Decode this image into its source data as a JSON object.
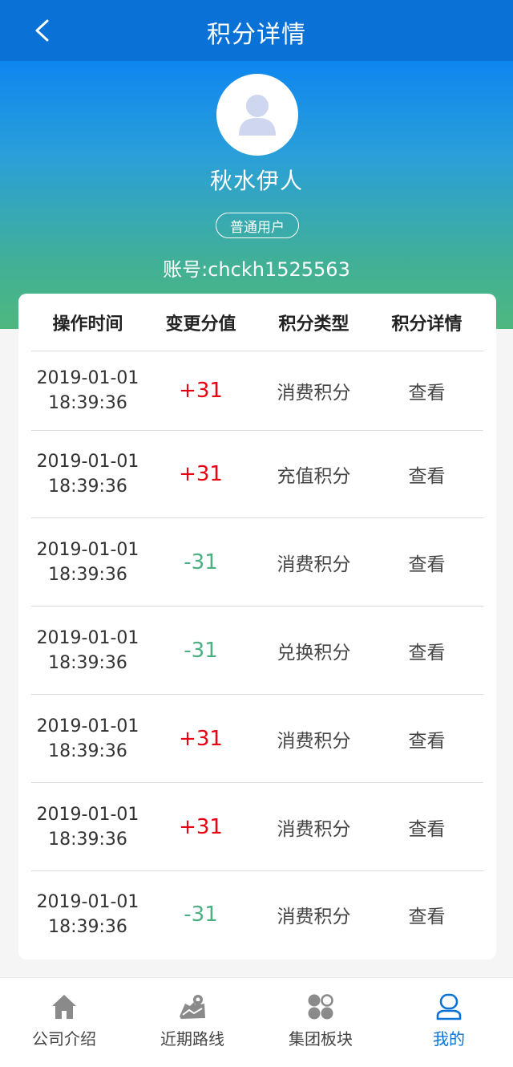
{
  "header": {
    "title": "积分详情"
  },
  "profile": {
    "name": "秋水伊人",
    "badge": "普通用户",
    "account": "账号:chckh1525563"
  },
  "table": {
    "columns": [
      "操作时间",
      "变更分值",
      "积分类型",
      "积分详情"
    ],
    "rows": [
      {
        "date": "2019-01-01",
        "time": "18:39:36",
        "value": "+31",
        "sign": "pos",
        "type": "消费积分",
        "action": "查看"
      },
      {
        "date": "2019-01-01",
        "time": "18:39:36",
        "value": "+31",
        "sign": "pos",
        "type": "充值积分",
        "action": "查看"
      },
      {
        "date": "2019-01-01",
        "time": "18:39:36",
        "value": "-31",
        "sign": "neg",
        "type": "消费积分",
        "action": "查看"
      },
      {
        "date": "2019-01-01",
        "time": "18:39:36",
        "value": "-31",
        "sign": "neg",
        "type": "兑换积分",
        "action": "查看"
      },
      {
        "date": "2019-01-01",
        "time": "18:39:36",
        "value": "+31",
        "sign": "pos",
        "type": "消费积分",
        "action": "查看"
      },
      {
        "date": "2019-01-01",
        "time": "18:39:36",
        "value": "+31",
        "sign": "pos",
        "type": "消费积分",
        "action": "查看"
      },
      {
        "date": "2019-01-01",
        "time": "18:39:36",
        "value": "-31",
        "sign": "neg",
        "type": "消费积分",
        "action": "查看"
      }
    ]
  },
  "tabbar": {
    "items": [
      {
        "label": "公司介绍",
        "icon": "home-icon"
      },
      {
        "label": "近期路线",
        "icon": "map-icon"
      },
      {
        "label": "集团板块",
        "icon": "grid-icon"
      },
      {
        "label": "我的",
        "icon": "user-icon",
        "active": true
      }
    ]
  },
  "colors": {
    "primary": "#0a72d6",
    "positive": "#e60012",
    "negative": "#4caf82"
  }
}
